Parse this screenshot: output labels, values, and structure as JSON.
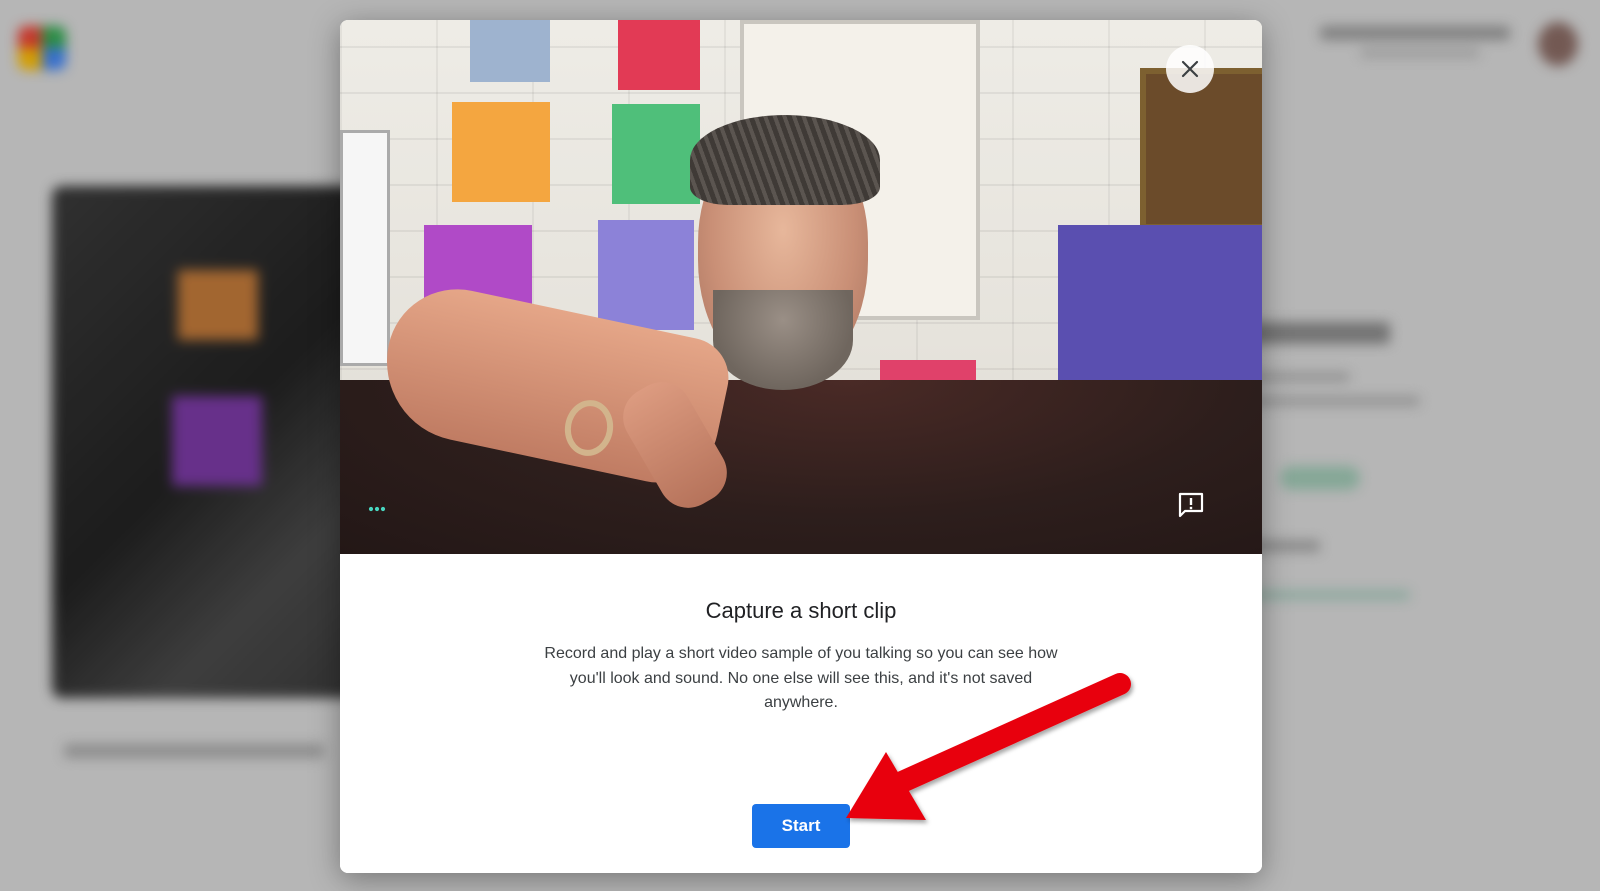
{
  "dialog": {
    "title": "Capture a short clip",
    "description": "Record and play a short video sample of you talking so you can see how you'll look and sound. No one else will see this, and it's not saved anywhere.",
    "start_label": "Start"
  },
  "icons": {
    "close": "close-icon",
    "more": "more-options-icon",
    "feedback": "feedback-icon"
  },
  "colors": {
    "primary_button": "#1a73e8",
    "annotation_arrow": "#e8000b"
  }
}
